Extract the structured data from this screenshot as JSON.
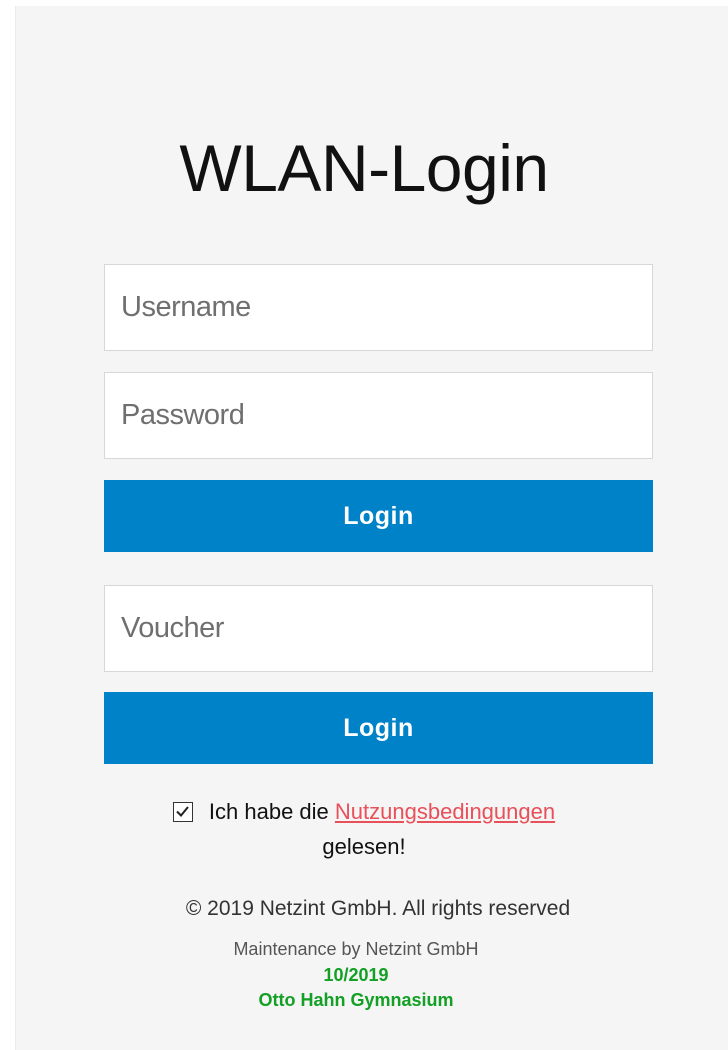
{
  "title": "WLAN-Login",
  "login_form": {
    "username_placeholder": "Username",
    "password_placeholder": "Password",
    "login_label": "Login"
  },
  "voucher_form": {
    "voucher_placeholder": "Voucher",
    "login_label": "Login"
  },
  "terms": {
    "checked": true,
    "prefix": "Ich habe die",
    "link": "Nutzungsbedingungen",
    "suffix": "gelesen!"
  },
  "footer": {
    "copyright": "© 2019 Netzint GmbH. All rights reserved",
    "maintenance": "Maintenance by Netzint GmbH",
    "date": "10/2019",
    "school": "Otto Hahn Gymnasium"
  },
  "colors": {
    "button": "#0082c8",
    "link": "#e8505a",
    "footer_green": "#13a024",
    "panel_background": "#f5f5f5"
  }
}
